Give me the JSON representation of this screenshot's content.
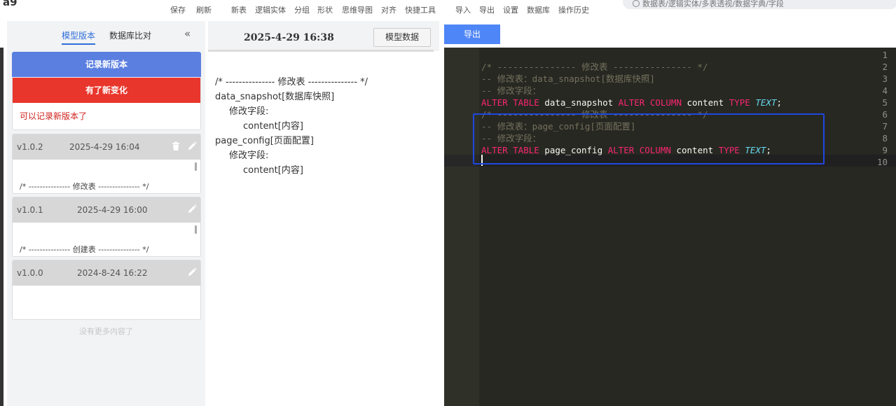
{
  "app": {
    "logo_text": "a9"
  },
  "toolbar": {
    "items": [
      "保存",
      "刷新",
      "新表",
      "逻辑实体",
      "分组",
      "形状",
      "思维导图",
      "对齐",
      "快捷工具",
      "导入",
      "导出",
      "设置",
      "数据库",
      "操作历史"
    ],
    "search_placeholder": "数据表/逻辑实体/多表透视/数据字典/字段"
  },
  "sidebar": {
    "tabs": [
      "模型版本",
      "数据库比对"
    ],
    "active_tab": "模型版本",
    "collapse_glyph": "«",
    "record_button": "记录新版本",
    "change_banner": "有了新变化",
    "change_message": "可以记录新版本了",
    "versions": [
      {
        "version": "v1.0.2",
        "time": "2025-4-29 16:04",
        "summary": "/* --------------- 修改表 --------------- */",
        "has_delete": true
      },
      {
        "version": "v1.0.1",
        "time": "2025-4-29 16:00",
        "summary": "/* --------------- 创建表 --------------- */",
        "has_delete": false
      },
      {
        "version": "v1.0.0",
        "time": "2024-8-24 16:22",
        "summary": "",
        "has_delete": false
      }
    ],
    "no_more": "没有更多内容了",
    "icons": {
      "delete": "trash-icon",
      "edit": "pencil-icon"
    }
  },
  "middle": {
    "time": "2025-4-29 16:38",
    "model_data_button": "模型数据",
    "lines": [
      {
        "text": "/* --------------- 修改表 --------------- */",
        "indent": 0
      },
      {
        "text": "data_snapshot[数据库快照]",
        "indent": 0
      },
      {
        "text": "修改字段:",
        "indent": 1
      },
      {
        "text": "content[内容]",
        "indent": 2
      },
      {
        "text": "page_config[页面配置]",
        "indent": 0
      },
      {
        "text": "修改字段:",
        "indent": 1
      },
      {
        "text": "content[内容]",
        "indent": 2
      }
    ]
  },
  "right": {
    "export_button": "导出",
    "line_numbers": [
      "1",
      "2",
      "3",
      "4",
      "5",
      "6",
      "7",
      "8",
      "9",
      "10"
    ],
    "code_lines": [
      [],
      [
        [
          "comment",
          "/* --------------- 修改表 --------------- */"
        ]
      ],
      [
        [
          "comment",
          "-- 修改表：data_snapshot[数据库快照]"
        ]
      ],
      [
        [
          "comment",
          "-- 修改字段："
        ]
      ],
      [
        [
          "kw",
          "ALTER TABLE "
        ],
        [
          "id",
          "data_snapshot "
        ],
        [
          "kw",
          "ALTER COLUMN "
        ],
        [
          "id",
          "content "
        ],
        [
          "kw",
          "TYPE "
        ],
        [
          "type",
          "TEXT"
        ],
        [
          "id",
          ";"
        ]
      ],
      [
        [
          "comment",
          "/* --------------- 修改表 --------------- */"
        ]
      ],
      [
        [
          "comment",
          "-- 修改表：page_config[页面配置]"
        ]
      ],
      [
        [
          "comment",
          "-- 修改字段："
        ]
      ],
      [
        [
          "kw",
          "ALTER TABLE "
        ],
        [
          "id",
          "page_config "
        ],
        [
          "kw",
          "ALTER COLUMN "
        ],
        [
          "id",
          "content "
        ],
        [
          "kw",
          "TYPE "
        ],
        [
          "type",
          "TEXT"
        ],
        [
          "id",
          ";"
        ]
      ],
      []
    ],
    "colors": {
      "comment": "#75715e",
      "keyword": "#f92672",
      "type": "#66d9ef",
      "highlight": "#1f47e0"
    }
  }
}
